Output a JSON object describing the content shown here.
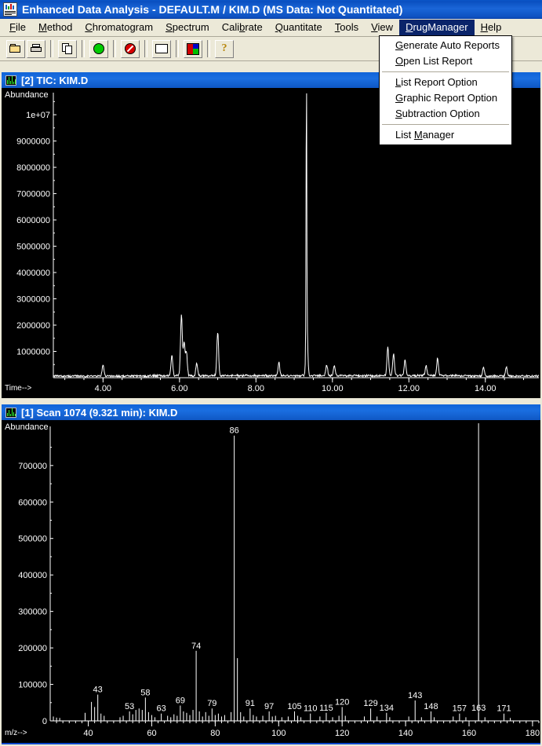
{
  "window": {
    "title": "Enhanced Data Analysis - DEFAULT.M / KIM.D   (MS Data: Not Quantitated)",
    "icon": "chromatogram-app-icon"
  },
  "menubar": {
    "items": [
      {
        "label": "File",
        "hotkey": "F"
      },
      {
        "label": "Method",
        "hotkey": "M"
      },
      {
        "label": "Chromatogram",
        "hotkey": "C"
      },
      {
        "label": "Spectrum",
        "hotkey": "S"
      },
      {
        "label": "Calibrate",
        "hotkey": "b"
      },
      {
        "label": "Quantitate",
        "hotkey": "Q"
      },
      {
        "label": "Tools",
        "hotkey": "T"
      },
      {
        "label": "View",
        "hotkey": "V"
      },
      {
        "label": "DrugManager",
        "hotkey": "D",
        "open": true
      },
      {
        "label": "Help",
        "hotkey": "H"
      }
    ]
  },
  "toolbar": {
    "buttons": [
      {
        "name": "open-file-button",
        "icon": "folder-open-icon"
      },
      {
        "name": "print-button",
        "icon": "printer-icon"
      },
      {
        "name": "copy-button",
        "icon": "copy-icon"
      },
      {
        "name": "start-button",
        "icon": "green-circle-icon"
      },
      {
        "name": "stop-button",
        "icon": "red-no-entry-icon"
      },
      {
        "name": "blank-box-button",
        "icon": "white-box-icon"
      },
      {
        "name": "color-palette-button",
        "icon": "color-quadrant-icon"
      },
      {
        "name": "help-button",
        "icon": "question-mark-icon"
      }
    ],
    "quadrant_colors": [
      "#e00000",
      "#0000d0",
      "#d00000",
      "#00c000"
    ]
  },
  "dropdown": {
    "title": "DrugManager",
    "groups": [
      [
        {
          "label": "Generate Auto Reports",
          "hotkey": "G"
        },
        {
          "label": "Open List Report",
          "hotkey": "O"
        }
      ],
      [
        {
          "label": "List Report Option",
          "hotkey": "L"
        },
        {
          "label": "Graphic Report Option",
          "hotkey": "G"
        },
        {
          "label": "Subtraction Option",
          "hotkey": "S"
        }
      ],
      [
        {
          "label": "List Manager",
          "hotkey": "M"
        }
      ]
    ]
  },
  "tic_window": {
    "title": "[2] TIC: KIM.D",
    "icon": "chromatogram-icon"
  },
  "spectrum_window": {
    "title": "[1] Scan 1074 (9.321 min): KIM.D",
    "icon": "spectrum-icon"
  },
  "chart_data": [
    {
      "id": "tic",
      "type": "line",
      "title": "[2] TIC: KIM.D",
      "ylabel": "Abundance",
      "xlabel": "Time-->",
      "xlim": [
        2.7,
        15.4
      ],
      "ylim": [
        0,
        10600000
      ],
      "xticks": [
        4.0,
        6.0,
        8.0,
        10.0,
        12.0,
        14.0
      ],
      "xticklabels": [
        "4.00",
        "6.00",
        "8.00",
        "10.00",
        "12.00",
        "14.00"
      ],
      "yticks": [
        1000000,
        2000000,
        3000000,
        4000000,
        5000000,
        6000000,
        7000000,
        8000000,
        9000000,
        10000000
      ],
      "yticklabels": [
        "1000000",
        "2000000",
        "3000000",
        "4000000",
        "5000000",
        "6000000",
        "7000000",
        "8000000",
        "9000000",
        "1e+07"
      ],
      "grid": false,
      "peaks": [
        {
          "x": 9.32,
          "y": 10250000
        },
        {
          "x": 9.33,
          "y": 2150000
        },
        {
          "x": 6.05,
          "y": 2350000
        },
        {
          "x": 6.12,
          "y": 1250000
        },
        {
          "x": 6.18,
          "y": 900000
        },
        {
          "x": 5.8,
          "y": 760000
        },
        {
          "x": 7.0,
          "y": 1680000
        },
        {
          "x": 4.0,
          "y": 430000
        },
        {
          "x": 6.45,
          "y": 480000
        },
        {
          "x": 8.6,
          "y": 500000
        },
        {
          "x": 9.85,
          "y": 420000
        },
        {
          "x": 10.05,
          "y": 380000
        },
        {
          "x": 11.45,
          "y": 1080000
        },
        {
          "x": 11.6,
          "y": 820000
        },
        {
          "x": 11.9,
          "y": 580000
        },
        {
          "x": 12.45,
          "y": 380000
        },
        {
          "x": 12.75,
          "y": 640000
        },
        {
          "x": 13.95,
          "y": 360000
        },
        {
          "x": 14.55,
          "y": 330000
        }
      ],
      "baseline_noise": 120000
    },
    {
      "id": "mass_spectrum",
      "type": "bar",
      "title": "[1] Scan 1074 (9.321 min): KIM.D",
      "ylabel": "Abundance",
      "xlabel": "m/z-->",
      "xlim": [
        28,
        182
      ],
      "ylim": [
        0,
        790000
      ],
      "xticks": [
        40,
        60,
        80,
        100,
        120,
        140,
        160,
        180
      ],
      "xticklabels": [
        "40",
        "60",
        "80",
        "100",
        "120",
        "140",
        "160",
        "180"
      ],
      "yticks": [
        0,
        100000,
        200000,
        300000,
        400000,
        500000,
        600000,
        700000
      ],
      "yticklabels": [
        "0",
        "100000",
        "200000",
        "300000",
        "400000",
        "500000",
        "600000",
        "700000"
      ],
      "grid": false,
      "cursor_mz": 163,
      "labeled_peaks": [
        43,
        53,
        58,
        63,
        69,
        74,
        79,
        86,
        91,
        97,
        105,
        110,
        115,
        120,
        129,
        134,
        143,
        148,
        157,
        163,
        171
      ],
      "mz": [
        29,
        30,
        31,
        39,
        41,
        42,
        43,
        44,
        45,
        50,
        51,
        53,
        54,
        55,
        56,
        57,
        58,
        59,
        60,
        61,
        63,
        65,
        66,
        67,
        68,
        69,
        70,
        71,
        72,
        73,
        74,
        75,
        76,
        77,
        78,
        79,
        80,
        81,
        82,
        83,
        85,
        86,
        87,
        88,
        89,
        91,
        92,
        93,
        95,
        97,
        98,
        99,
        101,
        103,
        105,
        106,
        107,
        110,
        113,
        115,
        117,
        119,
        120,
        121,
        127,
        129,
        131,
        134,
        135,
        141,
        143,
        145,
        148,
        149,
        155,
        157,
        159,
        163,
        165,
        171,
        173
      ],
      "intensity": [
        12000,
        9000,
        8000,
        22000,
        52000,
        38000,
        72000,
        20000,
        14000,
        10000,
        14000,
        26000,
        18000,
        30000,
        34000,
        30000,
        64000,
        24000,
        16000,
        10000,
        20000,
        14000,
        10000,
        18000,
        14000,
        42000,
        26000,
        22000,
        16000,
        30000,
        192000,
        26000,
        12000,
        24000,
        14000,
        34000,
        16000,
        20000,
        12000,
        16000,
        24000,
        782000,
        172000,
        24000,
        12000,
        34000,
        16000,
        12000,
        14000,
        26000,
        12000,
        14000,
        10000,
        12000,
        26000,
        14000,
        10000,
        20000,
        12000,
        22000,
        10000,
        14000,
        38000,
        14000,
        12000,
        34000,
        12000,
        22000,
        10000,
        12000,
        56000,
        10000,
        26000,
        10000,
        12000,
        20000,
        10000,
        22000,
        10000,
        20000,
        8000
      ]
    }
  ]
}
